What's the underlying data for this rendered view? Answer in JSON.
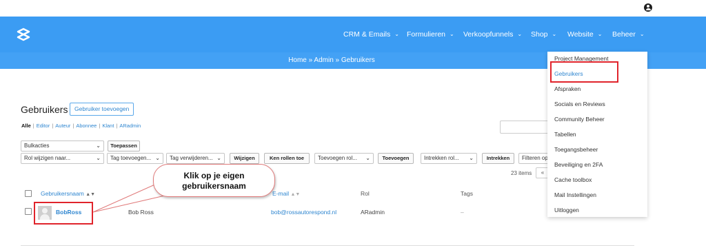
{
  "topbar": {
    "user_icon": "user-circle-icon"
  },
  "navbar": {
    "logo_icon": "brand-logo-icon",
    "items": [
      {
        "label": "CRM & Emails"
      },
      {
        "label": "Formulieren"
      },
      {
        "label": "Verkoopfunnels"
      },
      {
        "label": "Shop"
      },
      {
        "label": "Website"
      },
      {
        "label": "Beheer"
      }
    ]
  },
  "breadcrumb": "Home » Admin » Gebruikers",
  "page": {
    "title": "Gebruikers",
    "add_button": "Gebruiker toevoegen",
    "filters": {
      "current": "Alle",
      "links": [
        "Editor",
        "Auteur",
        "Abonnee",
        "Klant",
        "ARadmin"
      ]
    }
  },
  "toolbar": {
    "bulk_select": "Bulkacties",
    "apply_button": "Toepassen",
    "role_change_select": "Rol wijzigen naar...",
    "tag_add_select": "Tag toevoegen...",
    "tag_remove_select": "Tag verwijderen...",
    "change_button": "Wijzigen",
    "no_roles_button": "Ken rollen toe",
    "add_role_select": "Toevoegen rol...",
    "add_button": "Toevoegen",
    "revoke_role_select": "Intrekken rol...",
    "revoke_button": "Intrekken",
    "filter_label": "Filteren op"
  },
  "pagination": {
    "count": "23 items",
    "prev": "«"
  },
  "table": {
    "headers": {
      "username": "Gebruikersnaam",
      "email": "E-mail",
      "role": "Rol",
      "tags": "Tags"
    },
    "rows": [
      {
        "username": "BobRoss",
        "name": "Bob Ross",
        "email": "bob@rossautorespond.nl",
        "role": "ARadmin",
        "tags": "–"
      }
    ]
  },
  "callout": {
    "line1": "Klik op je eigen",
    "line2": "gebruikersnaam"
  },
  "dropdown": {
    "items": [
      {
        "label": "Project Management"
      },
      {
        "label": "Gebruikers"
      },
      {
        "label": "Afspraken"
      },
      {
        "label": "Socials en Reviews"
      },
      {
        "label": "Community Beheer"
      },
      {
        "label": "Tabellen"
      },
      {
        "label": "Toegangsbeheer"
      },
      {
        "label": "Beveiliging en 2FA"
      },
      {
        "label": "Cache toolbox"
      },
      {
        "label": "Mail Instellingen"
      },
      {
        "label": "Uitloggen"
      }
    ]
  },
  "colors": {
    "brand": "#3b9cf3",
    "highlight": "#e0232b",
    "link": "#2f86d0"
  }
}
